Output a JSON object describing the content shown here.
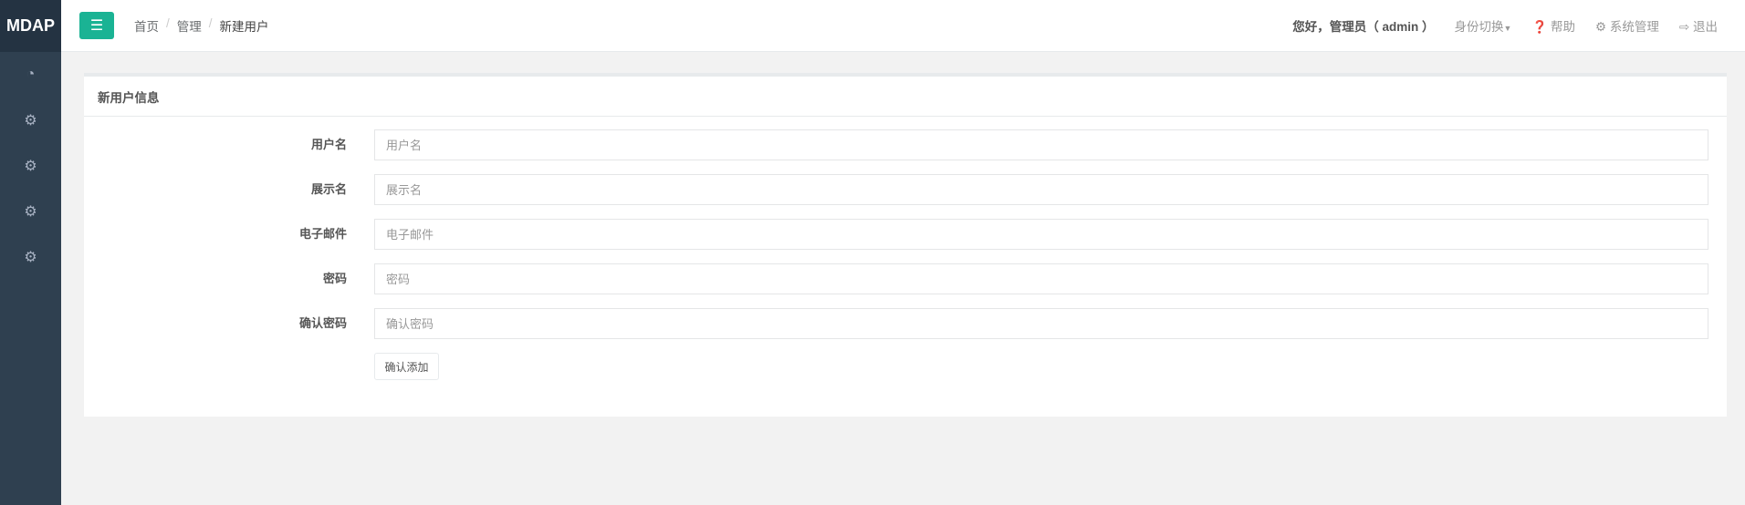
{
  "app": {
    "logo": "MDAP"
  },
  "header": {
    "breadcrumb": [
      "首页",
      "管理",
      "新建用户"
    ],
    "greeting": "您好，管理员（ admin ）",
    "switch_identity": "身份切换",
    "help": "帮助",
    "system_admin": "系统管理",
    "logout": "退出"
  },
  "panel": {
    "title": "新用户信息",
    "fields": [
      {
        "label": "用户名",
        "placeholder": "用户名",
        "value": ""
      },
      {
        "label": "展示名",
        "placeholder": "展示名",
        "value": ""
      },
      {
        "label": "电子邮件",
        "placeholder": "电子邮件",
        "value": ""
      },
      {
        "label": "密码",
        "placeholder": "密码",
        "value": ""
      },
      {
        "label": "确认密码",
        "placeholder": "确认密码",
        "value": ""
      }
    ],
    "submit": "确认添加"
  },
  "colors": {
    "accent": "#1ab394",
    "sidebar": "#2f4050"
  }
}
